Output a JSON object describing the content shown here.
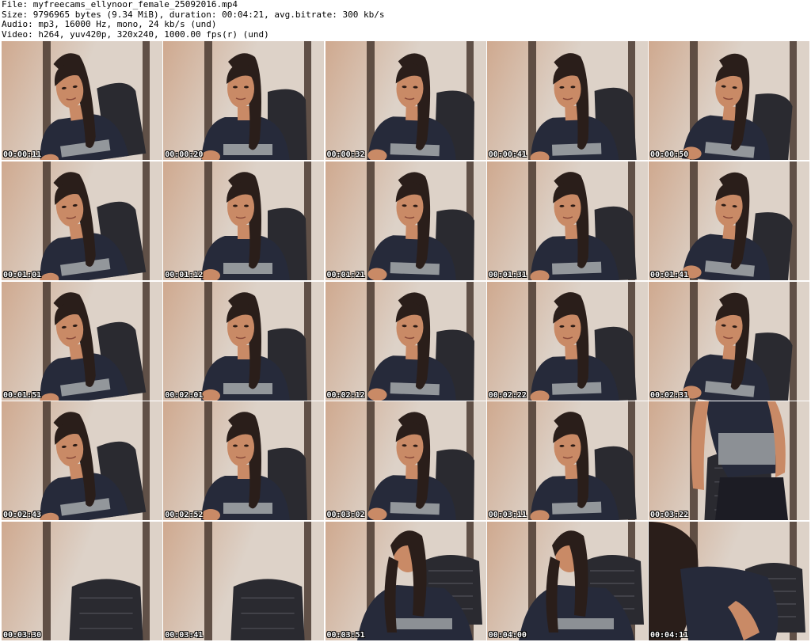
{
  "header": {
    "file_line": "File: myfreecams_ellynoor_female_25092016.mp4",
    "size_line": "Size: 9796965 bytes (9.34 MiB), duration: 00:04:21, avg.bitrate: 300 kb/s",
    "audio_line": "Audio: mp3, 16000 Hz, mono, 24 kb/s (und)",
    "video_line": "Video: h264, yuv420p, 320x240, 1000.00 fps(r) (und)"
  },
  "colors": {
    "wall": "#ddd2c8",
    "wall_warm": "#cfa98f",
    "beam": "#4a3a30",
    "chair": "#2a2a30",
    "shirt": "#262a3a",
    "shirt_print": "#b8bcbc",
    "skin": "#c98a66",
    "hair": "#2a1e1a"
  },
  "thumbnails": [
    {
      "time": "00:00:11",
      "scene": "person"
    },
    {
      "time": "00:00:20",
      "scene": "person"
    },
    {
      "time": "00:00:32",
      "scene": "person"
    },
    {
      "time": "00:00:41",
      "scene": "person"
    },
    {
      "time": "00:00:50",
      "scene": "person"
    },
    {
      "time": "00:01:01",
      "scene": "person"
    },
    {
      "time": "00:01:12",
      "scene": "person"
    },
    {
      "time": "00:01:21",
      "scene": "person"
    },
    {
      "time": "00:01:31",
      "scene": "person"
    },
    {
      "time": "00:01:41",
      "scene": "person"
    },
    {
      "time": "00:01:51",
      "scene": "person"
    },
    {
      "time": "00:02:01",
      "scene": "person"
    },
    {
      "time": "00:02:12",
      "scene": "person"
    },
    {
      "time": "00:02:22",
      "scene": "person"
    },
    {
      "time": "00:02:31",
      "scene": "person"
    },
    {
      "time": "00:02:43",
      "scene": "person"
    },
    {
      "time": "00:02:52",
      "scene": "person"
    },
    {
      "time": "00:03:02",
      "scene": "person"
    },
    {
      "time": "00:03:11",
      "scene": "person"
    },
    {
      "time": "00:03:22",
      "scene": "standing"
    },
    {
      "time": "00:03:30",
      "scene": "empty-chair"
    },
    {
      "time": "00:03:41",
      "scene": "empty-chair"
    },
    {
      "time": "00:03:51",
      "scene": "leaning"
    },
    {
      "time": "00:04:00",
      "scene": "leaning"
    },
    {
      "time": "00:04:11",
      "scene": "bending"
    }
  ]
}
